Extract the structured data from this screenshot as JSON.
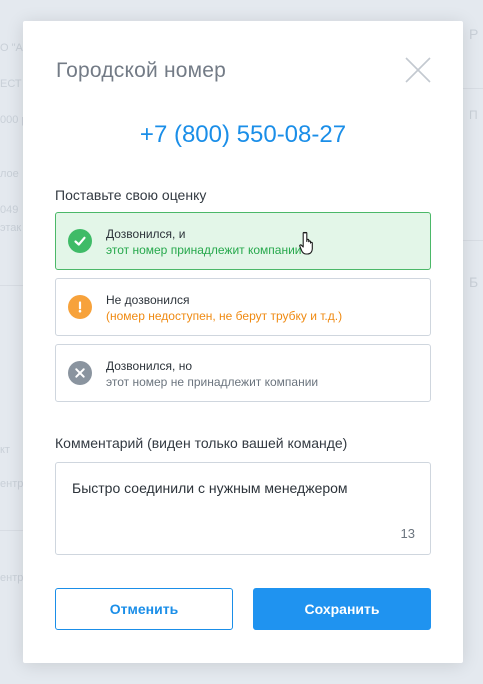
{
  "background": {
    "left_fragments": [
      "О \"АЛ",
      "ЕСТ",
      "000 р",
      "лое",
      "049",
      "этак",
      "кт",
      "ентр",
      "ентр"
    ],
    "right_fragments": [
      "Р",
      "П",
      "Б"
    ]
  },
  "modal": {
    "title": "Городской номер",
    "phone": "+7 (800) 550-08-27",
    "rate_label": "Поставьте свою оценку",
    "options": [
      {
        "line1": "Дозвонился, и",
        "line2": "этот номер принадлежит компании",
        "icon": "check-icon",
        "status": "selected",
        "color": "#3fbb67"
      },
      {
        "line1": "Не дозвонился",
        "line2": "(номер недоступен, не берут трубку и т.д.)",
        "icon": "exclamation-icon",
        "color": "#f7a23b"
      },
      {
        "line1": "Дозвонился, но",
        "line2": "этот номер не принадлежит компании",
        "icon": "x-icon",
        "color": "#8a949f"
      }
    ],
    "comment_label": "Комментарий (виден только вашей команде)",
    "comment_value": "Быстро соединили с нужным менеджером",
    "char_count": "13",
    "cancel_label": "Отменить",
    "save_label": "Сохранить"
  },
  "colors": {
    "accent": "#1a8ee8",
    "success": "#3fbb67",
    "warning": "#f7a23b"
  }
}
